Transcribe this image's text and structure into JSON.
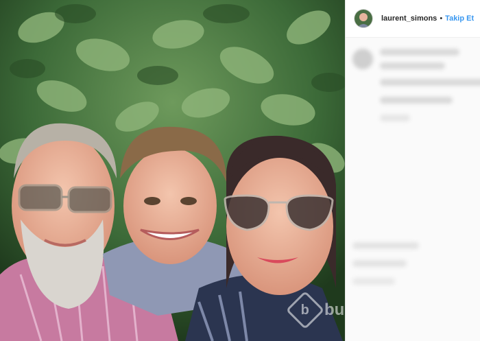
{
  "post": {
    "username": "laurent_simons",
    "separator": "•",
    "follow_label": "Takip Et"
  },
  "watermark": {
    "letter": "b",
    "text": "bu"
  },
  "colors": {
    "follow_blue": "#3897f0",
    "username": "#262626"
  }
}
